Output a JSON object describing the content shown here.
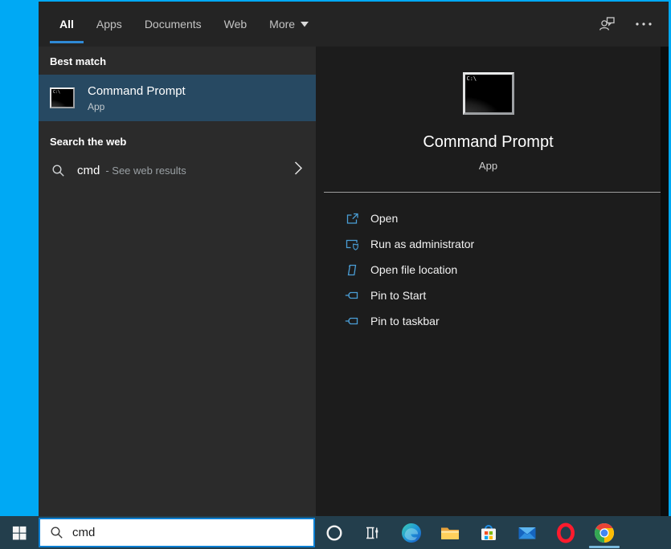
{
  "window": {
    "header": {
      "tabs": [
        {
          "label": "All",
          "active": true
        },
        {
          "label": "Apps",
          "active": false
        },
        {
          "label": "Documents",
          "active": false
        },
        {
          "label": "Web",
          "active": false
        },
        {
          "label": "More",
          "active": false,
          "caret_icon": "chevron-down-caret"
        }
      ],
      "icons": [
        "feedback-person-icon",
        "ellipsis-icon"
      ]
    },
    "left_panel": {
      "best_match_header": "Best match",
      "best_match_item": {
        "title": "Command Prompt",
        "type": "App",
        "icon": "command-prompt-icon",
        "selected": true
      },
      "web_section_header": "Search the web",
      "web_item": {
        "icon": "search-icon",
        "query": "cmd",
        "suffix": "- See web results",
        "chevron": "chevron-right-icon"
      }
    },
    "right_panel": {
      "icon": "command-prompt-icon",
      "cmd_icon_text": "C:\\",
      "app_title": "Command Prompt",
      "app_type": "App",
      "actions": [
        {
          "label": "Open",
          "icon": "open-window-icon"
        },
        {
          "label": "Run as administrator",
          "icon": "admin-shield-icon"
        },
        {
          "label": "Open file location",
          "icon": "file-location-icon"
        },
        {
          "label": "Pin to Start",
          "icon": "pin-icon"
        },
        {
          "label": "Pin to taskbar",
          "icon": "pin-icon"
        }
      ]
    }
  },
  "taskbar": {
    "start_icon": "windows-start-icon",
    "search": {
      "icon": "search-icon",
      "value": "cmd",
      "placeholder": ""
    },
    "app_icons": [
      "cortana-icon",
      "task-view-icon",
      "edge-icon",
      "file-explorer-icon",
      "store-icon",
      "mail-icon",
      "opera-icon",
      "chrome-icon"
    ],
    "active_app": "chrome"
  },
  "colors": {
    "wallpaper": "#00a9f4",
    "header_bg": "#242424",
    "left_panel_bg": "#2b2b2b",
    "right_panel_bg": "#1c1c1c",
    "selected_row": "#274962",
    "accent_underline": "#2f8ad6",
    "action_icon_blue": "#4a9ed6",
    "taskbar_bg": "#233e4c",
    "search_box_border": "#0c80d4",
    "chrome_active_underline": "#79b9dd"
  }
}
